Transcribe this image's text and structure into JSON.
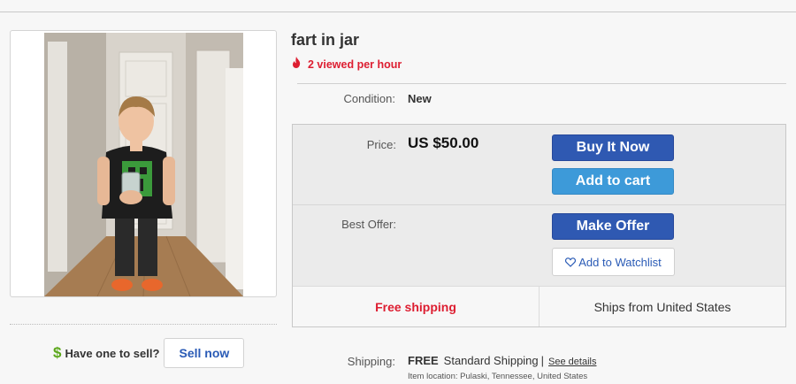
{
  "item": {
    "title": "fart in jar",
    "trending_text": "2 viewed per hour",
    "condition_label": "Condition:",
    "condition_value": "New"
  },
  "pricing": {
    "price_label": "Price:",
    "price_value": "US $50.00",
    "best_offer_label": "Best Offer:",
    "buy_now_label": "Buy It Now",
    "add_to_cart_label": "Add to cart",
    "make_offer_label": "Make Offer",
    "watchlist_label": "Add to Watchlist"
  },
  "shipping_band": {
    "free_shipping": "Free shipping",
    "ships_from": "Ships from United States"
  },
  "shipping": {
    "label": "Shipping:",
    "free": "FREE",
    "method": "Standard Shipping",
    "separator": "|",
    "see_details": "See details",
    "location": "Item location:  Pulaski, Tennessee, United States"
  },
  "sell": {
    "dollar": "$",
    "prompt": "Have one to sell?",
    "button_label": "Sell now"
  },
  "icons": {
    "trending": "fire-icon",
    "watchlist": "heart-icon",
    "sell": "dollar-icon"
  },
  "colors": {
    "primary_button": "#2f59b2",
    "secondary_button": "#3d9ad9",
    "alert_red": "#dd1e31",
    "link_blue": "#2a5bb6",
    "sell_green": "#5ba71b"
  }
}
